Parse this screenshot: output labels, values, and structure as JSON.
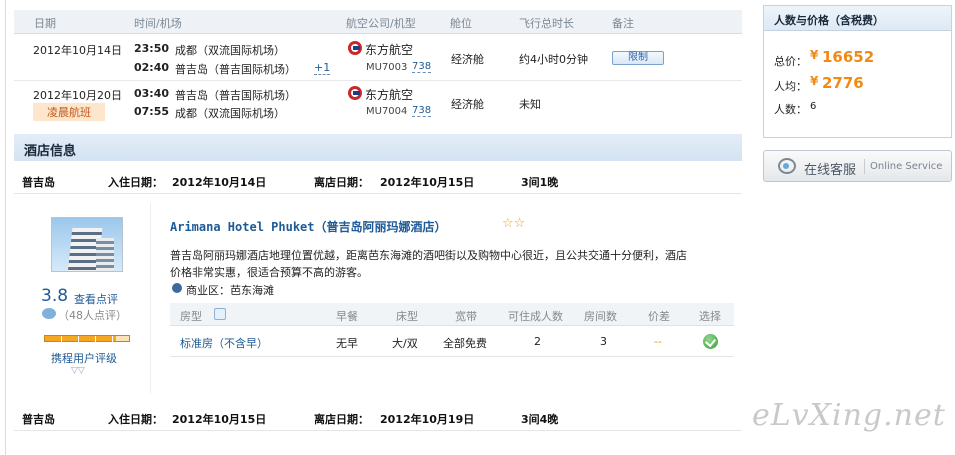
{
  "flight_table": {
    "headers": [
      "日期",
      "时间/机场",
      "航空公司/机型",
      "舱位",
      "飞行总时长",
      "备注"
    ],
    "rows": [
      {
        "date": "2012年10月14日",
        "dep_time": "23:50",
        "dep_airport": "成都（双流国际机场）",
        "arr_time": "02:40",
        "arr_airport": "普吉岛（普吉国际机场）",
        "plus_day": "+1",
        "airline": "东方航空",
        "flight_no": "MU7003",
        "aircraft": "738",
        "cabin": "经济舱",
        "duration": "约4小时0分钟",
        "note_button": "限制"
      },
      {
        "date": "2012年10月20日",
        "date_tag": "凌晨航班",
        "dep_time": "03:40",
        "dep_airport": "普吉岛（普吉国际机场）",
        "arr_time": "07:55",
        "arr_airport": "成都（双流国际机场）",
        "airline": "东方航空",
        "flight_no": "MU7004",
        "aircraft": "738",
        "cabin": "经济舱",
        "duration": "未知"
      }
    ]
  },
  "hotel_section": {
    "title": "酒店信息",
    "stays": [
      {
        "city": "普吉岛",
        "checkin_label": "入住日期：",
        "checkin": "2012年10月14日",
        "checkout_label": "离店日期：",
        "checkout": "2012年10月15日",
        "nights": "3间1晚"
      },
      {
        "city": "普吉岛",
        "checkin_label": "入住日期：",
        "checkin": "2012年10月15日",
        "checkout_label": "离店日期：",
        "checkout": "2012年10月19日",
        "nights": "3间4晚"
      }
    ],
    "hotel": {
      "name": "Arimana Hotel Phuket（普吉岛阿丽玛娜酒店）",
      "stars": "☆☆",
      "description_line1": "普吉岛阿丽玛娜酒店地理位置优越，距离芭东海滩的酒吧街以及购物中心很近，且公共交通十分便利，酒店",
      "description_line2": "价格非常实惠，很适合预算不高的游客。",
      "district": "商业区：芭东海滩",
      "score": "3.8",
      "review_link": "查看点评",
      "review_count": "（48人点评）",
      "user_rating_label": "携程用户评级",
      "rating_fraction": 0.85
    },
    "room_table": {
      "headers": [
        "房型",
        "早餐",
        "床型",
        "宽带",
        "可住成人数",
        "房间数",
        "价差",
        "选择"
      ],
      "rows": [
        {
          "room_type": "标准房（不含早）",
          "breakfast": "无早",
          "bed": "大/双",
          "broadband": "全部免费",
          "adults": "2",
          "rooms": "3",
          "price_diff": "--"
        }
      ]
    }
  },
  "price_panel": {
    "title": "人数与价格（含税费）",
    "total_label": "总价：",
    "total_currency": "¥",
    "total_value": "16652",
    "avg_label": "人均：",
    "avg_currency": "¥",
    "avg_value": "2776",
    "people_label": "人数：",
    "people_value": "6"
  },
  "online_service": {
    "label_cn": "在线客服",
    "label_en": "Online Service"
  },
  "watermark": "eLvXing.net",
  "colors": {
    "price_orange": "#f08a14",
    "link_blue": "#1e5a96",
    "header_bg": "#eef2f6"
  }
}
